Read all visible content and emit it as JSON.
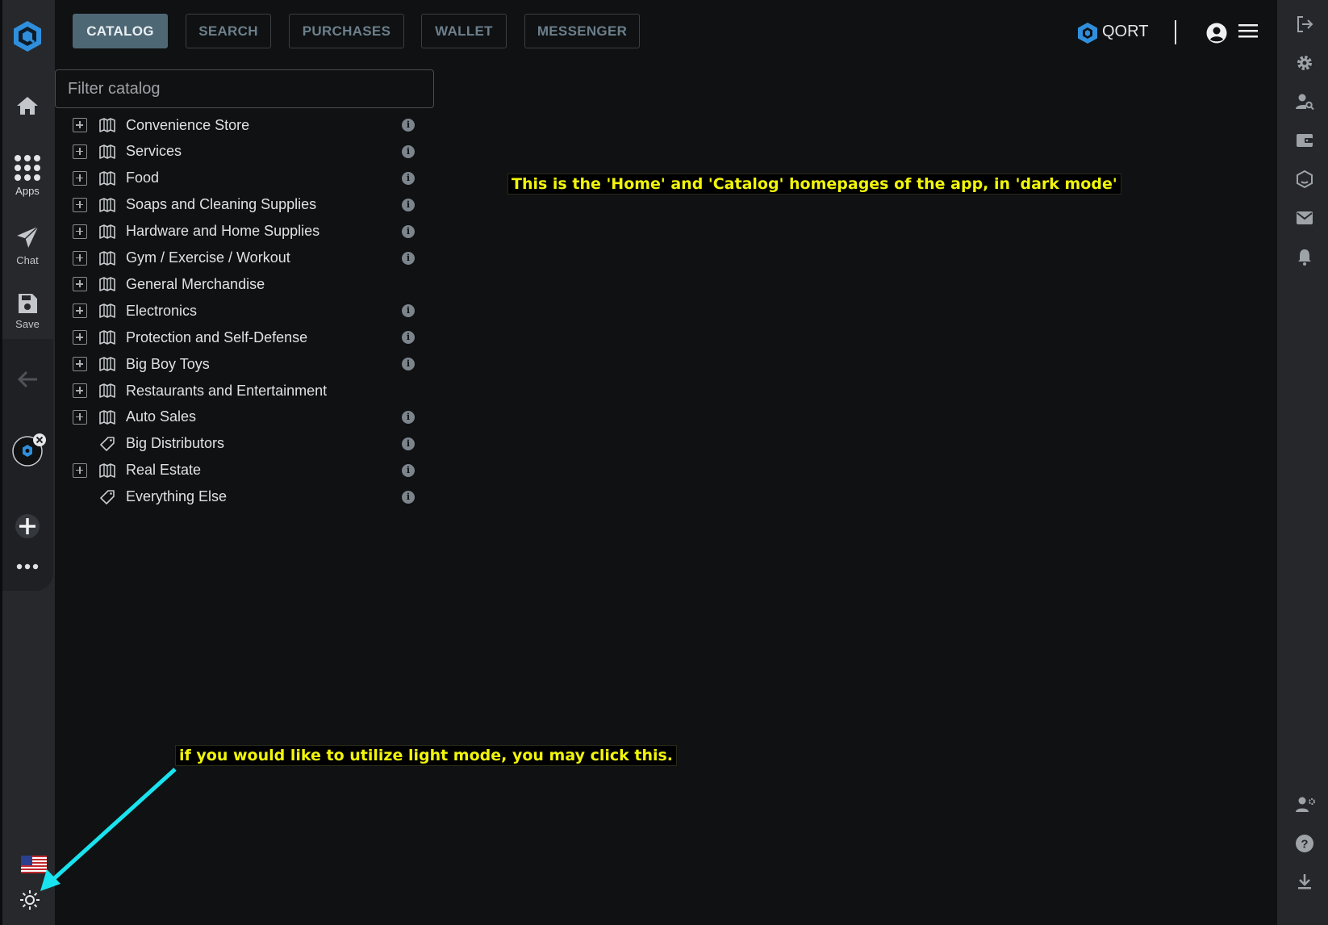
{
  "left_sidebar": {
    "nav": [
      {
        "label": "",
        "icon": "home-icon"
      },
      {
        "label": "Apps",
        "icon": "apps-grid-icon"
      },
      {
        "label": "Chat",
        "icon": "send-icon"
      },
      {
        "label": "Save",
        "icon": "save-icon"
      }
    ],
    "language_flag": "🇺🇸"
  },
  "tabs": [
    {
      "label": "CATALOG",
      "active": true
    },
    {
      "label": "SEARCH",
      "active": false
    },
    {
      "label": "PURCHASES",
      "active": false
    },
    {
      "label": "WALLET",
      "active": false
    },
    {
      "label": "MESSENGER",
      "active": false
    }
  ],
  "header": {
    "coin_label": "QORT"
  },
  "filter": {
    "placeholder": "Filter catalog",
    "value": ""
  },
  "catalog": [
    {
      "label": "Convenience Store",
      "expandable": true,
      "type": "book",
      "info": true
    },
    {
      "label": "Services",
      "expandable": true,
      "type": "book",
      "info": true
    },
    {
      "label": "Food",
      "expandable": true,
      "type": "book",
      "info": true
    },
    {
      "label": "Soaps and Cleaning Supplies",
      "expandable": true,
      "type": "book",
      "info": true
    },
    {
      "label": "Hardware and Home Supplies",
      "expandable": true,
      "type": "book",
      "info": true
    },
    {
      "label": "Gym / Exercise / Workout",
      "expandable": true,
      "type": "book",
      "info": true
    },
    {
      "label": "General Merchandise",
      "expandable": true,
      "type": "book",
      "info": false
    },
    {
      "label": "Electronics",
      "expandable": true,
      "type": "book",
      "info": true
    },
    {
      "label": "Protection and Self-Defense",
      "expandable": true,
      "type": "book",
      "info": true
    },
    {
      "label": "Big Boy Toys",
      "expandable": true,
      "type": "book",
      "info": true
    },
    {
      "label": "Restaurants and Entertainment",
      "expandable": true,
      "type": "book",
      "info": false
    },
    {
      "label": "Auto Sales",
      "expandable": true,
      "type": "book",
      "info": true
    },
    {
      "label": "Big Distributors",
      "expandable": false,
      "type": "tag",
      "info": true
    },
    {
      "label": "Real Estate",
      "expandable": true,
      "type": "book",
      "info": true
    },
    {
      "label": "Everything Else",
      "expandable": false,
      "type": "tag",
      "info": true
    }
  ],
  "annotations": {
    "top": "This is the 'Home' and 'Catalog' homepages of the app, in 'dark mode'",
    "bottom": "if you would like to utilize light mode, you may click this."
  },
  "colors": {
    "background": "#0f1112",
    "sidebar": "#26282b",
    "active_tab": "#4e6774",
    "annotation_text": "#f1f50a",
    "arrow": "#19e3ee",
    "logo_blue": "#2f8fdc"
  }
}
